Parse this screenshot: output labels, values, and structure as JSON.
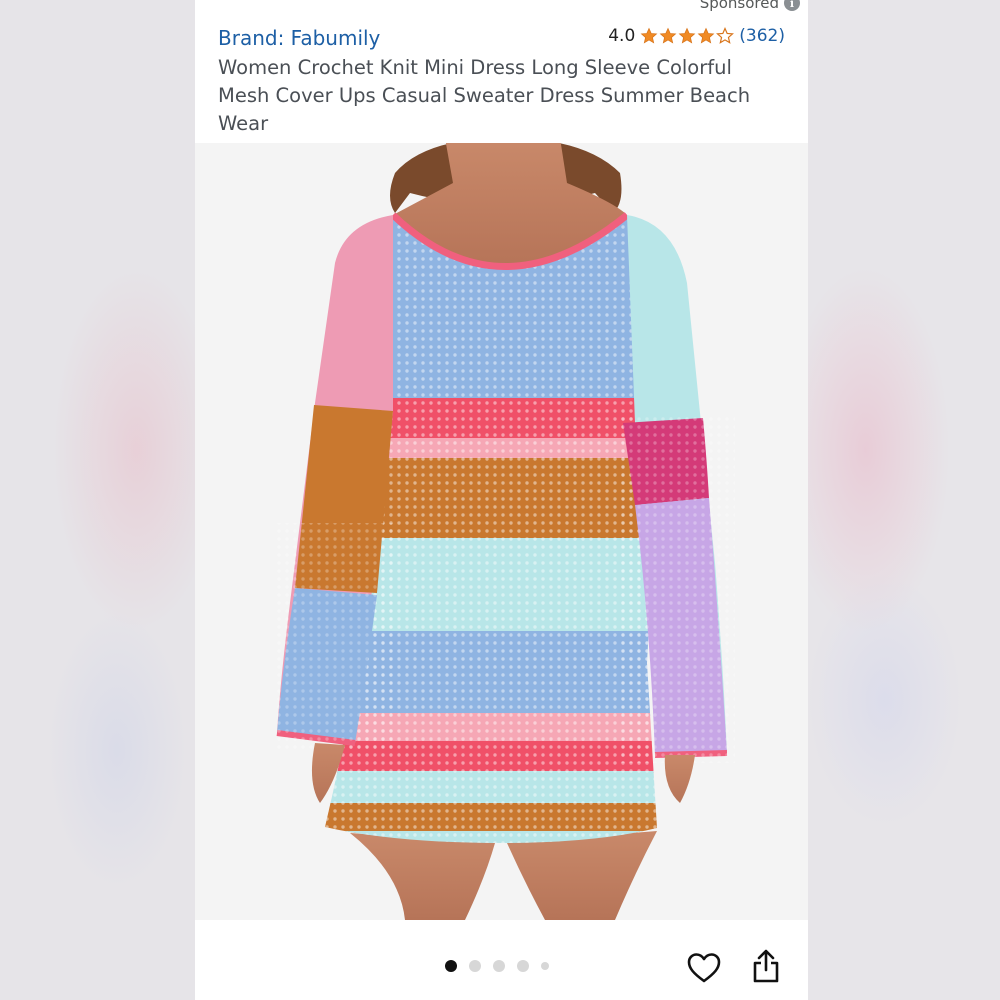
{
  "header": {
    "sponsored_label": "Sponsored",
    "brand_label": "Brand: Fabumily",
    "rating_value": "4.0",
    "rating_stars": 4,
    "review_count": "(362)",
    "product_title": "Women Crochet Knit Mini Dress Long Sleeve Colorful Mesh Cover Ups Casual Sweater Dress Summer Beach Wear"
  },
  "image_carousel": {
    "total_images": 5,
    "active_index": 0
  },
  "colors": {
    "link_blue": "#1d5fa5",
    "star_orange": "#f08a24",
    "dress_pink": "#ee9bb4",
    "dress_orange": "#c9782f",
    "dress_blue": "#8fb4e2",
    "dress_red": "#f05068",
    "dress_mint": "#b8e6e8"
  },
  "icons": {
    "info": "info-icon",
    "heart": "heart-icon",
    "share": "share-icon"
  }
}
